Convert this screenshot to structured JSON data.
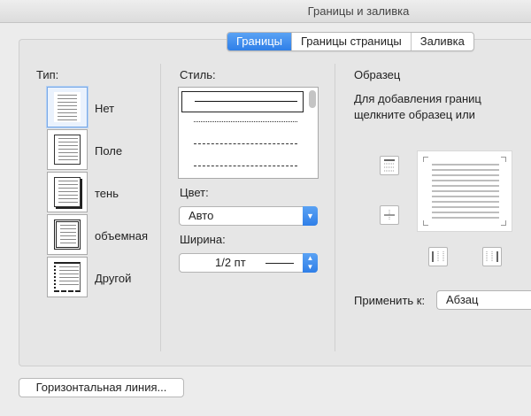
{
  "window": {
    "title": "Границы и заливка"
  },
  "tabs": [
    {
      "label": "Границы",
      "active": true
    },
    {
      "label": "Границы страницы",
      "active": false
    },
    {
      "label": "Заливка",
      "active": false
    }
  ],
  "type_section": {
    "label": "Тип:",
    "items": [
      {
        "label": "Нет",
        "icon": "border-none-icon",
        "selected": true
      },
      {
        "label": "Поле",
        "icon": "border-box-icon",
        "selected": false
      },
      {
        "label": "тень",
        "icon": "border-shadow-icon",
        "selected": false
      },
      {
        "label": "объемная",
        "icon": "border-3d-icon",
        "selected": false
      },
      {
        "label": "Другой",
        "icon": "border-custom-icon",
        "selected": false
      }
    ]
  },
  "style_section": {
    "label": "Стиль:",
    "line_styles": [
      "solid",
      "dotted",
      "dashed",
      "long-dashed"
    ],
    "selected_style": "solid"
  },
  "color_section": {
    "label": "Цвет:",
    "value": "Авто"
  },
  "width_section": {
    "label": "Ширина:",
    "value": "1/2 пт"
  },
  "preview_section": {
    "label": "Образец",
    "hint": "Для добавления границ щелкните образец или используйте кнопки",
    "buttons": [
      "border-top-icon",
      "border-middle-icon",
      "border-left-icon",
      "border-right-icon"
    ]
  },
  "apply_to": {
    "label": "Применить к:",
    "value": "Абзац"
  },
  "footer": {
    "horizontal_line_button": "Горизонтальная линия..."
  },
  "colors": {
    "accent": "#2f7fe8",
    "background": "#ececec"
  }
}
